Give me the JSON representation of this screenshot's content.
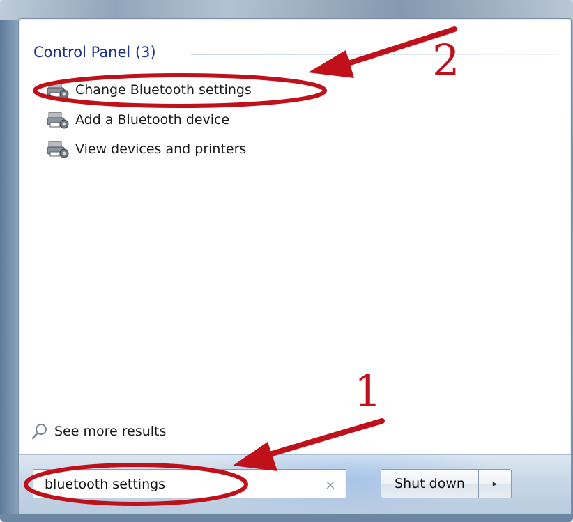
{
  "results": {
    "group_header": "Control Panel (3)",
    "items": [
      {
        "label": "Change Bluetooth settings",
        "icon": "devices-printers-icon"
      },
      {
        "label": "Add a Bluetooth device",
        "icon": "devices-printers-icon"
      },
      {
        "label": "View devices and printers",
        "icon": "devices-printers-icon"
      }
    ]
  },
  "see_more": {
    "label": "See more results",
    "icon": "search-icon"
  },
  "search": {
    "value": "bluetooth settings",
    "clear_glyph": "×"
  },
  "shutdown": {
    "label": "Shut down",
    "arrow_glyph": "▸"
  },
  "annotations": {
    "step_1": "1",
    "step_2": "2",
    "color": "#c0101a"
  },
  "colors": {
    "header_text": "#1e3287",
    "bottom_bar": "#c9d8e8"
  }
}
